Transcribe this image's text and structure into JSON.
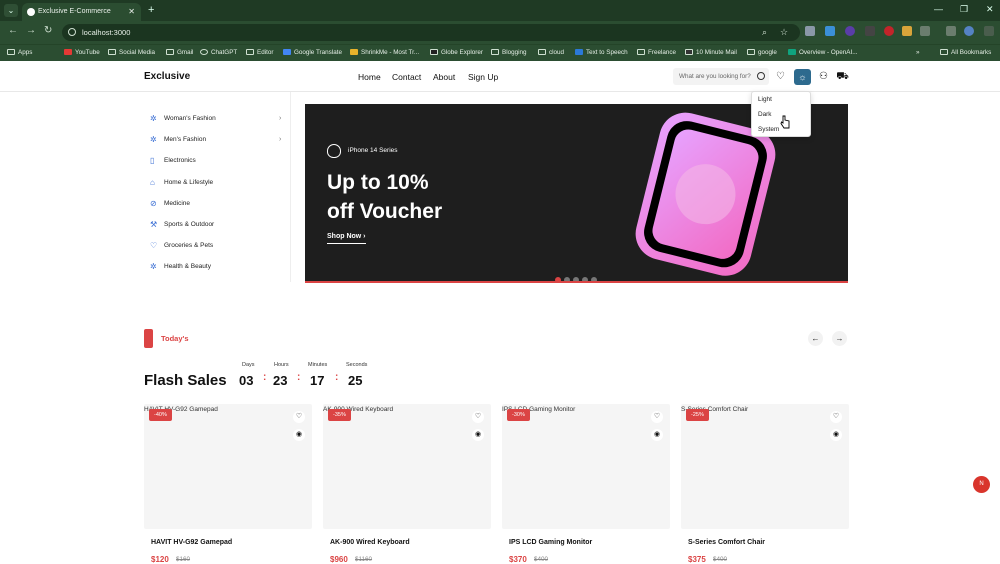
{
  "browser": {
    "tab_title": "Exclusive E-Commerce",
    "url": "localhost:3000",
    "bookmarks": [
      "Apps",
      "YouTube",
      "Social Media",
      "Gmail",
      "ChatGPT",
      "Editor",
      "Google Translate",
      "ShrinkMe - Most Tr...",
      "Globe Explorer",
      "Blogging",
      "cloud",
      "Text to Speech",
      "Freelance",
      "10 Minute Mail",
      "google",
      "Overview - OpenAI...",
      "All Bookmarks"
    ]
  },
  "header": {
    "logo": "Exclusive",
    "nav": [
      "Home",
      "Contact",
      "About",
      "Sign Up"
    ],
    "search_placeholder": "What are you looking for?"
  },
  "theme_menu": [
    "Light",
    "Dark",
    "System"
  ],
  "categories": [
    {
      "label": "Woman's Fashion",
      "has_submenu": true
    },
    {
      "label": "Men's Fashion",
      "has_submenu": true
    },
    {
      "label": "Electronics",
      "has_submenu": false
    },
    {
      "label": "Home & Lifestyle",
      "has_submenu": false
    },
    {
      "label": "Medicine",
      "has_submenu": false
    },
    {
      "label": "Sports & Outdoor",
      "has_submenu": false
    },
    {
      "label": "Groceries & Pets",
      "has_submenu": false
    },
    {
      "label": "Health & Beauty",
      "has_submenu": false
    }
  ],
  "hero": {
    "series": "iPhone 14 Series",
    "headline_1": "Up to 10%",
    "headline_2": "off Voucher",
    "cta": "Shop Now",
    "slides": 5,
    "active_slide": 1
  },
  "flash": {
    "tag": "Today's",
    "title": "Flash Sales",
    "countdown": [
      {
        "label": "Days",
        "value": "03"
      },
      {
        "label": "Hours",
        "value": "23"
      },
      {
        "label": "Minutes",
        "value": "17"
      },
      {
        "label": "Seconds",
        "value": "25"
      }
    ]
  },
  "products": [
    {
      "alt": "HAVIT HV-G92 Gamepad",
      "name": "HAVIT HV-G92 Gamepad",
      "discount": "-40%",
      "price": "$120",
      "old_price": "$160"
    },
    {
      "alt": "AK-900 Wired Keyboard",
      "name": "AK-900 Wired Keyboard",
      "discount": "-35%",
      "price": "$960",
      "old_price": "$1160"
    },
    {
      "alt": "IPS LCD Gaming Monitor",
      "name": "IPS LCD Gaming Monitor",
      "discount": "-30%",
      "price": "$370",
      "old_price": "$400"
    },
    {
      "alt": "S-Series Comfort Chair",
      "name": "S-Series Comfort Chair",
      "discount": "-25%",
      "price": "$375",
      "old_price": "$400"
    }
  ],
  "colors": {
    "accent": "#db4444",
    "browser": "#2b4d31",
    "theme_button": "#2d6a8e"
  },
  "fab_label": "N"
}
